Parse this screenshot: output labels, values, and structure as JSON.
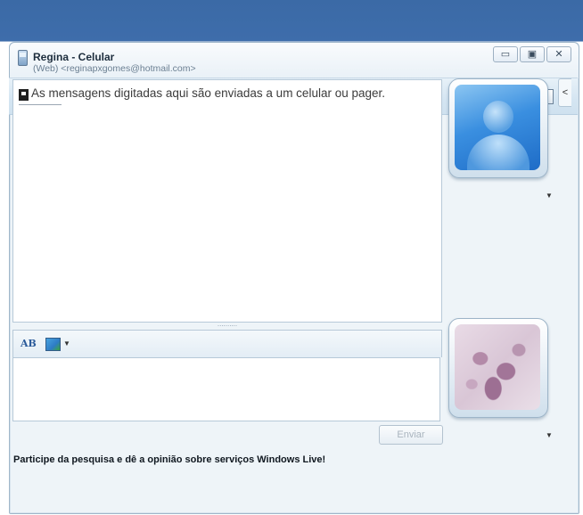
{
  "window": {
    "contact_name": "Regina - Celular",
    "contact_email": "(Web) <reginapxgomes@hotmail.com>",
    "controls": {
      "minimize": "▭",
      "maximize": "▣",
      "close": "✕"
    }
  },
  "toolbar": {
    "icons": [
      "email-icon",
      "sms-icon",
      "block-contact-icon",
      "paint-brush-icon",
      "menu-icon"
    ]
  },
  "conversation": {
    "notice": "As mensagens digitadas aqui são enviadas a um celular ou pager."
  },
  "splitter": "..........",
  "compose": {
    "spell_label": "AB",
    "input_value": "",
    "send_label": "Enviar"
  },
  "footer": {
    "survey_text": "Participe da pesquisa e dê a opinião sobre serviços Windows Live!"
  },
  "side": {
    "collapse_glyph": "<",
    "dropdown_glyph": "▼"
  }
}
